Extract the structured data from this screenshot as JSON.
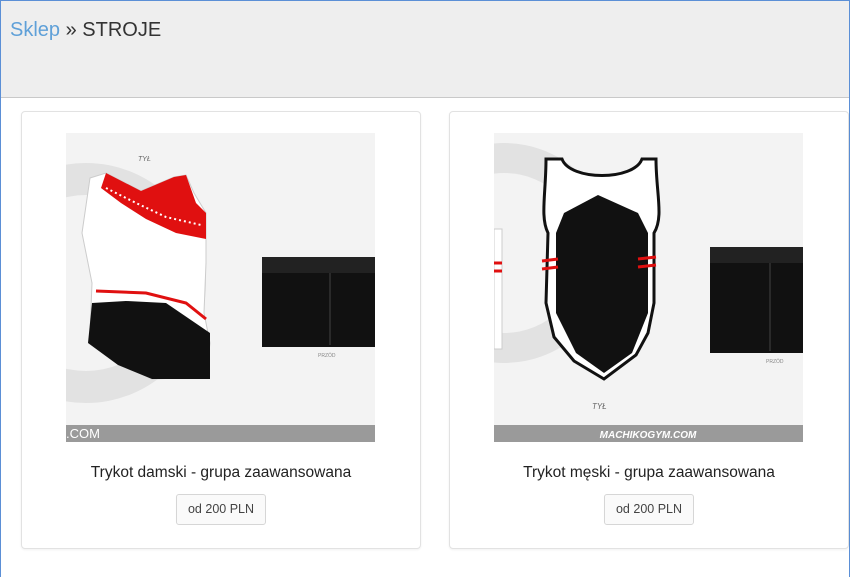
{
  "breadcrumb": {
    "shop_link": "Sklep",
    "separator": "»",
    "current": "STROJE"
  },
  "products": [
    {
      "title": "Trykot damski - grupa zaawansowana",
      "price": "od 200 PLN",
      "image": {
        "back_label": "TYŁ",
        "front_label": "PRZÓD",
        "watermark": ".COM"
      }
    },
    {
      "title": "Trykot męski - grupa zaawansowana",
      "price": "od 200 PLN",
      "image": {
        "back_label": "TYŁ",
        "front_label": "PRZÓD",
        "watermark": "MACHIKOGYM.COM"
      }
    }
  ],
  "colors": {
    "link": "#5fa0d8",
    "red": "#e01010",
    "black": "#111111"
  }
}
